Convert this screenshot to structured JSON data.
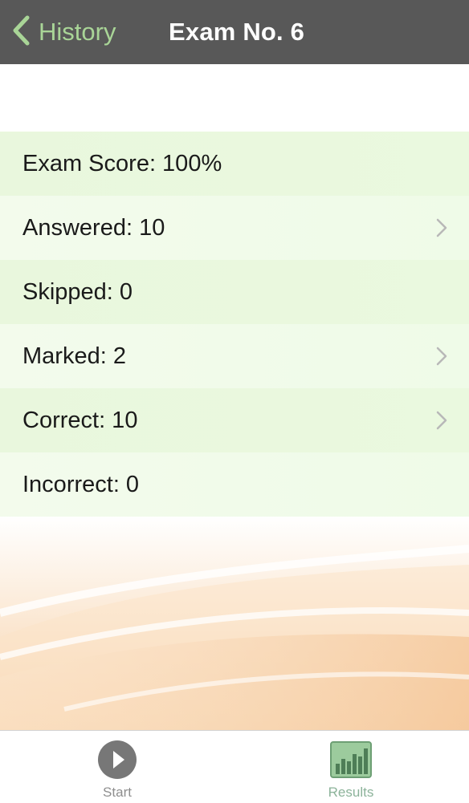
{
  "navbar": {
    "back_label": "History",
    "title": "Exam No. 6"
  },
  "results": [
    {
      "label": "Exam Score: 100%",
      "has_chevron": false
    },
    {
      "label": "Answered: 10",
      "has_chevron": true
    },
    {
      "label": "Skipped: 0",
      "has_chevron": false
    },
    {
      "label": "Marked: 2",
      "has_chevron": true
    },
    {
      "label": "Correct: 10",
      "has_chevron": true
    },
    {
      "label": "Incorrect: 0",
      "has_chevron": false
    }
  ],
  "tabbar": {
    "start_label": "Start",
    "results_label": "Results",
    "start_icon": "play-icon",
    "results_icon": "bar-chart-icon"
  },
  "colors": {
    "navbar": "#585858",
    "back_accent": "#a9d597",
    "row_tint": "#eaf8df",
    "background_wave": "#f6cda0"
  }
}
